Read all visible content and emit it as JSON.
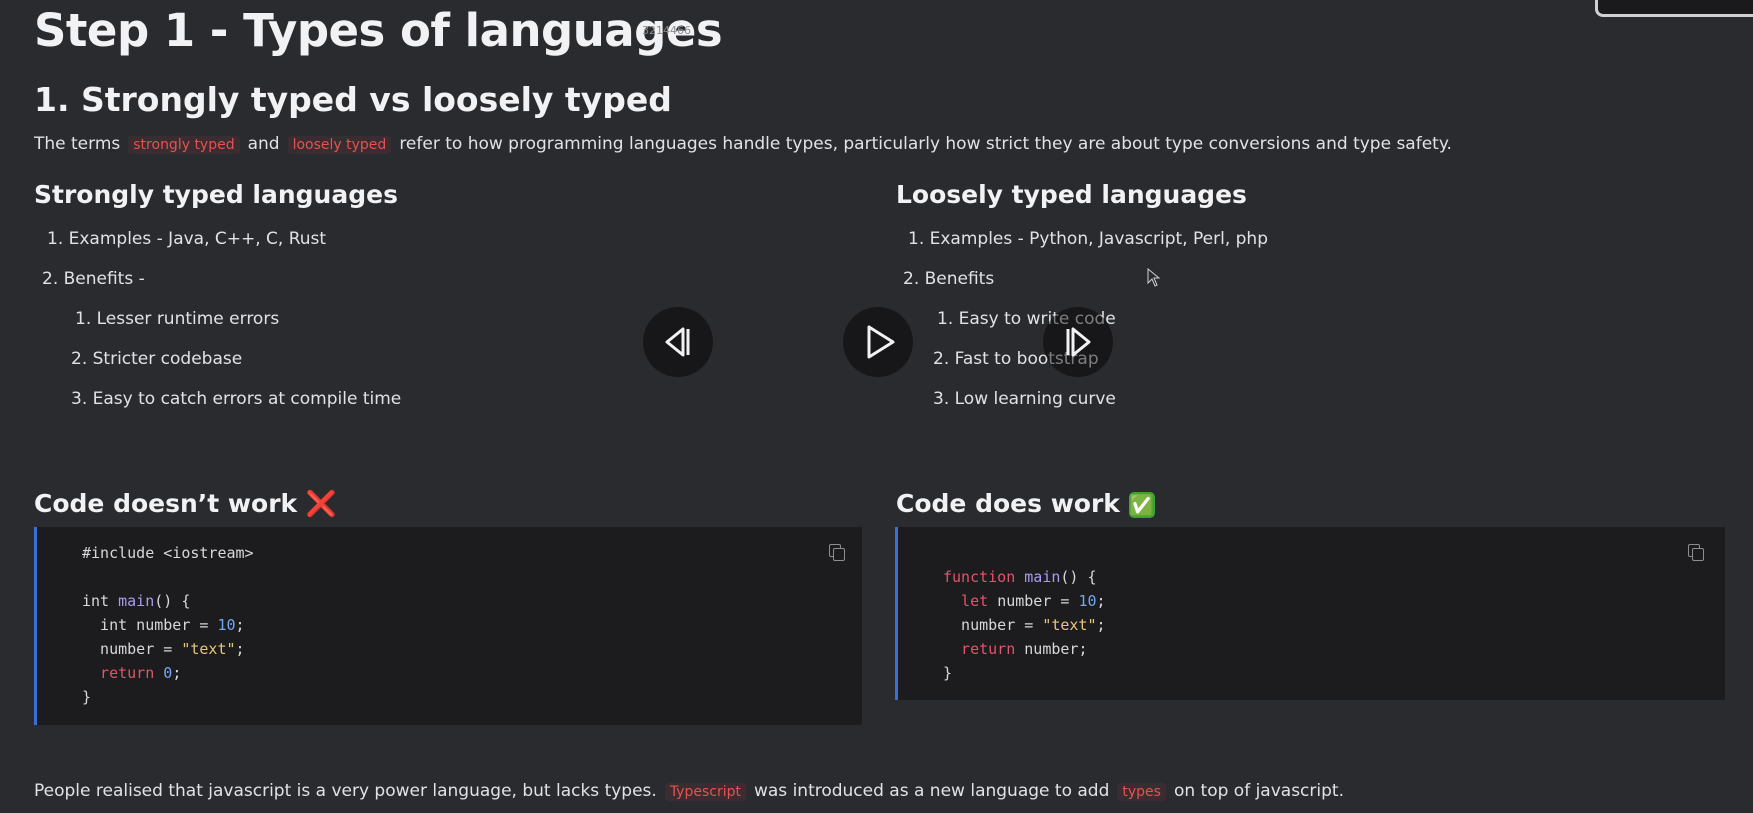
{
  "page": {
    "title": "Step 1 - Types of languages",
    "watermark": "3214466",
    "section_title": "1. Strongly typed vs loosely typed",
    "intro": {
      "prefix": "The terms",
      "tag1": "strongly typed",
      "middle": "and",
      "tag2": "loosely typed",
      "suffix": "refer to how programming languages handle types, particularly how strict they are about type conversions and type safety."
    }
  },
  "strong": {
    "heading": "Strongly typed languages",
    "examples": "1. Examples - Java, C++, C, Rust",
    "benefits": "2. Benefits -",
    "sub": [
      "1. Lesser runtime errors",
      "2. Stricter codebase",
      "3. Easy to catch errors at compile time"
    ]
  },
  "loose": {
    "heading": "Loosely typed languages",
    "examples": "1. Examples - Python, Javascript, Perl, php",
    "benefits": "2. Benefits",
    "sub": [
      "1. Easy to write code",
      "2. Fast to bootstrap",
      "3. Low learning curve"
    ]
  },
  "code_left": {
    "heading": "Code doesn’t work",
    "emoji": "❌",
    "lines": [
      "#include <iostream>",
      "",
      "int main() {",
      "  int number = 10;",
      "  number = \"text\";",
      "  return 0;",
      "}"
    ]
  },
  "code_right": {
    "heading": "Code does work",
    "emoji": "✅",
    "lines": [
      "function main() {",
      "  let number = 10;",
      "  number = \"text\";",
      "  return number;",
      "}"
    ]
  },
  "footer": {
    "prefix": "People realised that javascript is a very power language, but lacks types.",
    "tag1": "Typescript",
    "middle": "was introduced as a new language to add",
    "tag2": "types",
    "suffix": "on top of javascript."
  },
  "icons": {
    "previous": "skip-back-icon",
    "play": "play-icon",
    "next": "skip-forward-icon",
    "copy": "copy-icon",
    "cursor": "mouse-cursor-icon"
  },
  "colors": {
    "background": "#2a2b2f",
    "code_background": "#1c1c1e",
    "code_border": "#3a6fd8",
    "tag_text": "#e0554f",
    "keyword": "#e0556a",
    "function": "#a99cf0",
    "number": "#74a6f0",
    "string": "#e8c47a"
  }
}
